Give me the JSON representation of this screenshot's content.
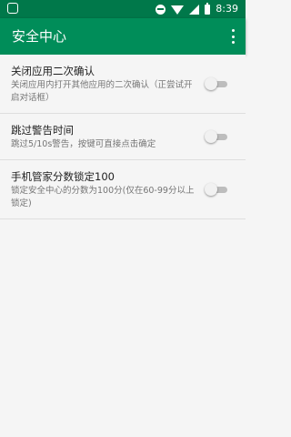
{
  "status_bar": {
    "time": "8:39",
    "icons": [
      "notification-icon",
      "do-not-disturb-icon",
      "wifi-icon",
      "signal-icon",
      "battery-icon"
    ]
  },
  "app_bar": {
    "title": "安全中心",
    "overflow_icon": "more-vert-icon"
  },
  "settings": [
    {
      "title": "关闭应用二次确认",
      "summary": "关闭应用内打开其他应用的二次确认（正尝试开启对话框）",
      "enabled": false
    },
    {
      "title": "跳过警告时间",
      "summary": "跳过5/10s警告，按键可直接点击确定",
      "enabled": false
    },
    {
      "title": "手机管家分数锁定100",
      "summary": "锁定安全中心的分数为100分(仅在60-99分以上锁定)",
      "enabled": false
    }
  ],
  "colors": {
    "status_bar": "#00784a",
    "app_bar": "#008d59",
    "background": "#f5f5f5"
  }
}
